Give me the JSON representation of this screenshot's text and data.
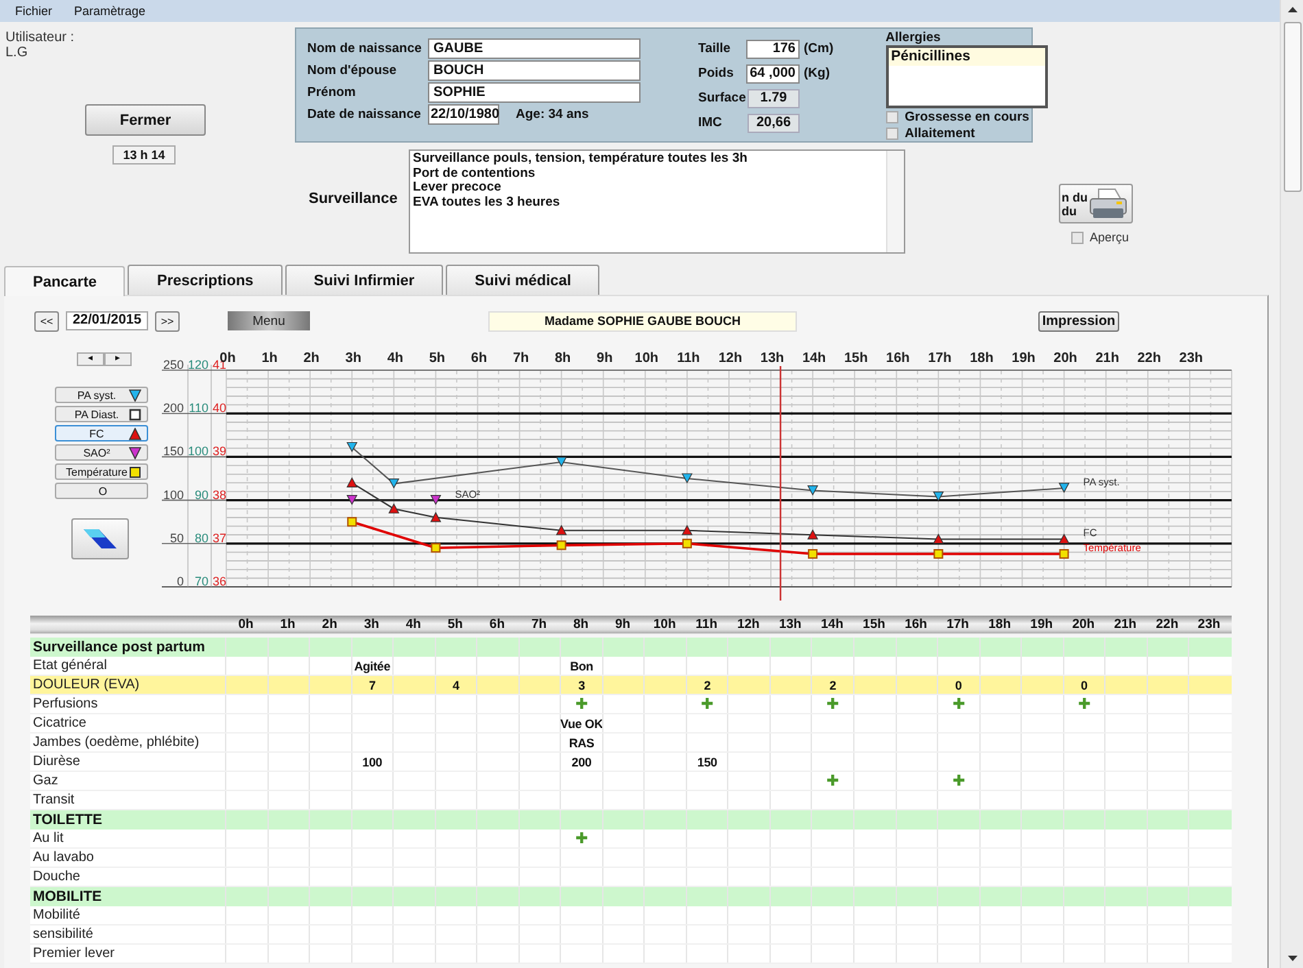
{
  "menu": [
    {
      "label": "Fichier"
    },
    {
      "label": "Paramètrage"
    }
  ],
  "user": {
    "label": "Utilisateur :",
    "name": "L.G"
  },
  "close_button": "Fermer",
  "clock": "13 h 14",
  "patient": {
    "fields": [
      {
        "label": "Nom de naissance",
        "value": "GAUBE"
      },
      {
        "label": "Nom d'épouse",
        "value": "BOUCH"
      },
      {
        "label": "Prénom",
        "value": "SOPHIE"
      },
      {
        "label": "Date de naissance",
        "value": "22/10/1980"
      }
    ],
    "age": "Age: 34 ans",
    "measures": [
      {
        "label": "Taille",
        "value": "176",
        "unit": "(Cm)",
        "kind": "input"
      },
      {
        "label": "Poids",
        "value": "64 ,000",
        "unit": "(Kg)",
        "kind": "input"
      },
      {
        "label": "Surface",
        "value": "1.79",
        "kind": "readonly"
      },
      {
        "label": "IMC",
        "value": "20,66",
        "kind": "readonly"
      }
    ],
    "allergies": {
      "label": "Allergies",
      "items": [
        "Pénicillines"
      ]
    },
    "flags": [
      {
        "label": "Grossesse en cours",
        "checked": false
      },
      {
        "label": "Allaitement",
        "checked": false
      }
    ]
  },
  "surveillance": {
    "label": "Surveillance",
    "lines": [
      "Surveillance pouls, tension, température toutes les 3h",
      "Port de contentions",
      "Lever precoce",
      "EVA toutes les 3 heures"
    ]
  },
  "print_button": {
    "lines": [
      "n du",
      "du"
    ]
  },
  "preview": {
    "label": "Aperçu",
    "checked": false
  },
  "tabs": [
    {
      "label": "Pancarte",
      "selected": true
    },
    {
      "label": "Prescriptions",
      "selected": false
    },
    {
      "label": "Suivi Infirmier",
      "selected": false
    },
    {
      "label": "Suivi médical",
      "selected": false
    }
  ],
  "toolbar": {
    "prev": "<<",
    "date": "22/01/2015",
    "next": ">>",
    "menu": "Menu",
    "patient_name": "Madame SOPHIE  GAUBE BOUCH",
    "print": "Impression"
  },
  "pager": {
    "prev": "◂",
    "next": "▸"
  },
  "legend": [
    {
      "label": "PA syst.",
      "kind": "tri-down",
      "color": "#22b4ec",
      "selected": false
    },
    {
      "label": "PA Diast.",
      "kind": "square-open",
      "color": "#333333",
      "selected": false
    },
    {
      "label": "FC",
      "kind": "tri-up",
      "color": "#dd1111",
      "selected": true
    },
    {
      "label": "SAO²",
      "kind": "tri-down",
      "color": "#cc33cc",
      "selected": false
    },
    {
      "label": "Température",
      "kind": "square",
      "color": "#f2e000",
      "selected": false
    },
    {
      "label": "O",
      "kind": "none",
      "selected": false
    }
  ],
  "chart": {
    "scales": [
      {
        "color": "#2a8c7c",
        "labels": [
          "120",
          "110",
          "100",
          "90",
          "80",
          "70"
        ]
      },
      {
        "color": "#dd2222",
        "labels": [
          "41",
          "40",
          "39",
          "38",
          "37",
          "36"
        ]
      }
    ],
    "marker_fills": [
      {
        "color": "#22b4ec",
        "kind": "down"
      },
      {
        "color": "#dd1111",
        "kind": "up"
      },
      {
        "color": "#cc33cc",
        "kind": "down"
      },
      {
        "color": "#f2e000"
      }
    ],
    "chart_data": {
      "type": "line",
      "x": [
        3,
        4,
        5,
        8,
        11,
        14,
        17,
        20
      ],
      "xticks": [
        {
          "value": 0,
          "label": "0h"
        },
        {
          "value": 1,
          "label": "1h"
        },
        {
          "value": 2,
          "label": "2h"
        },
        {
          "value": 3,
          "label": "3h"
        },
        {
          "value": 4,
          "label": "4h"
        },
        {
          "value": 5,
          "label": "5h"
        },
        {
          "value": 6,
          "label": "6h"
        },
        {
          "value": 7,
          "label": "7h"
        },
        {
          "value": 8,
          "label": "8h"
        },
        {
          "value": 9,
          "label": "9h"
        },
        {
          "value": 10,
          "label": "10h"
        },
        {
          "value": 11,
          "label": "11h"
        },
        {
          "value": 12,
          "label": "12h"
        },
        {
          "value": 13,
          "label": "13h"
        },
        {
          "value": 14,
          "label": "14h"
        },
        {
          "value": 15,
          "label": "15h"
        },
        {
          "value": 16,
          "label": "16h"
        },
        {
          "value": 17,
          "label": "17h"
        },
        {
          "value": 18,
          "label": "18h"
        },
        {
          "value": 19,
          "label": "19h"
        },
        {
          "value": 20,
          "label": "20h"
        },
        {
          "value": 21,
          "label": "21h"
        },
        {
          "value": 22,
          "label": "22h"
        },
        {
          "value": 23,
          "label": "23h"
        }
      ],
      "xlim": [
        0,
        24
      ],
      "ylim": [
        0,
        250
      ],
      "yticks": [
        0,
        50,
        100,
        150,
        200,
        250
      ],
      "grid": true,
      "ref_lines": [
        {
          "axis": "x",
          "value": 13.23,
          "color": "#cc3333"
        }
      ],
      "series": [
        {
          "name": "PA syst.",
          "color": "#555555",
          "marker": "triangle",
          "values": [
            161,
            119,
            null,
            144,
            125,
            111,
            104,
            114
          ]
        },
        {
          "name": "FC",
          "color": "#333333",
          "marker": "triangle",
          "values": [
            120,
            90,
            80,
            65,
            65,
            60,
            55,
            55
          ]
        },
        {
          "name": "SAO²",
          "color": "#333333",
          "marker": "triangle",
          "values": [
            100,
            null,
            100,
            null,
            null,
            null,
            null,
            null
          ]
        },
        {
          "name": "Température",
          "color": "#e00000",
          "marker": "square",
          "values": [
            75,
            null,
            45,
            48,
            50,
            38,
            38,
            38
          ]
        }
      ]
    }
  },
  "table": {
    "columns": [
      "0h",
      "1h",
      "2h",
      "3h",
      "4h",
      "5h",
      "6h",
      "7h",
      "8h",
      "9h",
      "10h",
      "11h",
      "12h",
      "13h",
      "14h",
      "15h",
      "16h",
      "17h",
      "18h",
      "19h",
      "20h",
      "21h",
      "22h",
      "23h"
    ],
    "rows": [
      {
        "kind": "section",
        "label": "Surveillance post partum",
        "highlighted": false
      },
      {
        "kind": "row",
        "label": "Etat général",
        "highlighted": false,
        "cells": [
          null,
          null,
          null,
          "Agitée",
          null,
          null,
          null,
          null,
          "Bon",
          null,
          null,
          null,
          null,
          null,
          null,
          null,
          null,
          null,
          null,
          null,
          null,
          null,
          null,
          null
        ]
      },
      {
        "kind": "row",
        "label": "DOULEUR (EVA)",
        "highlighted": true,
        "cells": [
          null,
          null,
          null,
          "7",
          null,
          "4",
          null,
          null,
          "3",
          null,
          null,
          "2",
          null,
          null,
          "2",
          null,
          null,
          "0",
          null,
          null,
          "0",
          null,
          null,
          null
        ]
      },
      {
        "kind": "row",
        "label": "Perfusions",
        "highlighted": false,
        "cells": [
          null,
          null,
          null,
          null,
          null,
          null,
          null,
          null,
          "✚",
          null,
          null,
          "✚",
          null,
          null,
          "✚",
          null,
          null,
          "✚",
          null,
          null,
          "✚",
          null,
          null,
          null
        ]
      },
      {
        "kind": "row",
        "label": "Cicatrice",
        "highlighted": false,
        "cells": [
          null,
          null,
          null,
          null,
          null,
          null,
          null,
          null,
          "Vue OK",
          null,
          null,
          null,
          null,
          null,
          null,
          null,
          null,
          null,
          null,
          null,
          null,
          null,
          null,
          null
        ]
      },
      {
        "kind": "row",
        "label": "Jambes (oedème, phlébite)",
        "highlighted": false,
        "cells": [
          null,
          null,
          null,
          null,
          null,
          null,
          null,
          null,
          "RAS",
          null,
          null,
          null,
          null,
          null,
          null,
          null,
          null,
          null,
          null,
          null,
          null,
          null,
          null,
          null
        ]
      },
      {
        "kind": "row",
        "label": "Diurèse",
        "highlighted": false,
        "cells": [
          null,
          null,
          null,
          "100",
          null,
          null,
          null,
          null,
          "200",
          null,
          null,
          "150",
          null,
          null,
          null,
          null,
          null,
          null,
          null,
          null,
          null,
          null,
          null,
          null
        ]
      },
      {
        "kind": "row",
        "label": "Gaz",
        "highlighted": false,
        "cells": [
          null,
          null,
          null,
          null,
          null,
          null,
          null,
          null,
          null,
          null,
          null,
          null,
          null,
          null,
          "✚",
          null,
          null,
          "✚",
          null,
          null,
          null,
          null,
          null,
          null
        ]
      },
      {
        "kind": "row",
        "label": "Transit",
        "highlighted": false
      },
      {
        "kind": "section",
        "label": "TOILETTE",
        "highlighted": false
      },
      {
        "kind": "row",
        "label": "Au lit",
        "highlighted": false,
        "cells": [
          null,
          null,
          null,
          null,
          null,
          null,
          null,
          null,
          "✚",
          null,
          null,
          null,
          null,
          null,
          null,
          null,
          null,
          null,
          null,
          null,
          null,
          null,
          null,
          null
        ]
      },
      {
        "kind": "row",
        "label": "Au lavabo",
        "highlighted": false
      },
      {
        "kind": "row",
        "label": "Douche",
        "highlighted": false
      },
      {
        "kind": "section",
        "label": "MOBILITE",
        "highlighted": false
      },
      {
        "kind": "row",
        "label": "Mobilité",
        "highlighted": false
      },
      {
        "kind": "row",
        "label": "sensibilité",
        "highlighted": false
      },
      {
        "kind": "row",
        "label": "Premier lever",
        "highlighted": false
      }
    ]
  }
}
